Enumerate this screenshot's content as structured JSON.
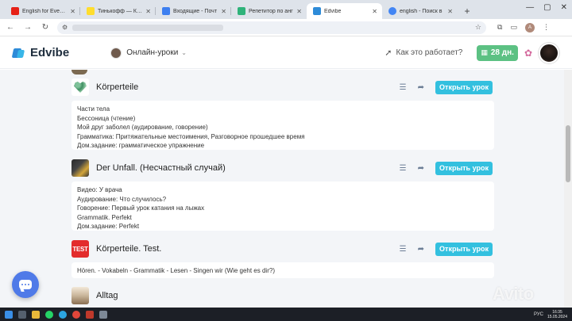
{
  "browser": {
    "tabs": [
      {
        "title": "English for Everyday",
        "favicon_color": "#e62117",
        "active": false
      },
      {
        "title": "Тинькофф — Кред",
        "favicon_color": "#ffdd2d",
        "active": false
      },
      {
        "title": "Входящие - Почт",
        "favicon_color": "#3d7ff0",
        "active": false
      },
      {
        "title": "Репетитор по анг",
        "favicon_color": "#2fb37a",
        "active": false
      },
      {
        "title": "Edvibe",
        "favicon_color": "#2e8bd8",
        "active": true
      },
      {
        "title": "english - Поиск в",
        "favicon_color": "#4285f4",
        "active": false
      }
    ],
    "profile_initial": "A"
  },
  "app": {
    "logo": "Edvibe",
    "mode_label": "Онлайн-уроки",
    "how_it_works": "Как это работает?",
    "days_badge": "28 дн."
  },
  "lessons": [
    {
      "title": "Körperteile",
      "thumb": "heart",
      "button": "Открыть урок",
      "lines": [
        "Части тела",
        "Бессоница (чтение)",
        "Мой друг заболел (аудирование, говорение)",
        "Грамматика: Притяжательные местоимения, Разговорное прошедшее время",
        "Дом.задание: грамматическое упражнение"
      ]
    },
    {
      "title": "Der Unfall. (Несчастный случай)",
      "thumb": "unfall",
      "button": "Открыть урок",
      "lines": [
        "Видео: У врача",
        "Аудирование: Что случилось?",
        "Говорение: Первый урок катания на лыжах",
        "Grammatik. Perfekt",
        "Дом.задание: Perfekt"
      ]
    },
    {
      "title": "Körperteile. Test.",
      "thumb": "test",
      "thumb_text": "TEST",
      "button": "Открыть урок",
      "lines": [
        "Hören. - Vokabeln - Grammatik - Lesen - Singen wir (Wie geht es dir?)"
      ]
    },
    {
      "title": "Alltag",
      "thumb": "alltag"
    }
  ],
  "watermark": "Avito",
  "taskbar": {
    "lang": "РУС",
    "time": "16:35",
    "date": "15.05.2024"
  },
  "colors": {
    "accent_button": "#33c0df",
    "days_badge": "#5cc183",
    "chat_fab": "#4f7ae8"
  }
}
